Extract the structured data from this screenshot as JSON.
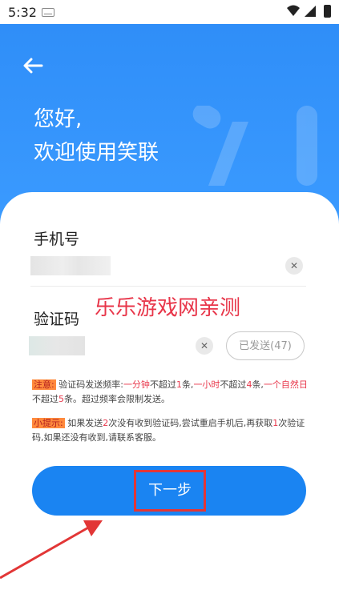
{
  "status_bar": {
    "time": "5:32"
  },
  "header": {
    "back_icon": "back-arrow-icon",
    "greeting_line1": "您好,",
    "greeting_line2": "欢迎使用笑联"
  },
  "form": {
    "phone_label": "手机号",
    "code_label": "验证码",
    "resend_label": "已发送(47)",
    "watermark": "乐乐游戏网亲测"
  },
  "notices": {
    "notice_tag": "注意:",
    "notice_text_a": "验证码发送频率:",
    "notice_red_a": "一分钟",
    "notice_text_b": "不超过",
    "notice_red_b": "1",
    "notice_text_c": "条,",
    "notice_red_c": "一小时",
    "notice_text_d": "不超过",
    "notice_red_d": "4",
    "notice_text_e": "条,",
    "notice_red_e": "一个自然日",
    "notice_text_f": "不超过",
    "notice_red_f": "5",
    "notice_text_g": "条。超过频率会限制发送。",
    "tip_tag": "小提示:",
    "tip_text_a": "如果发送",
    "tip_red_a": "2",
    "tip_text_b": "次没有收到验证码,尝试重启手机后,再获取",
    "tip_red_b": "1",
    "tip_text_c": "次验证码,如果还没有收到,请联系客服。"
  },
  "actions": {
    "next_label": "下一步"
  },
  "colors": {
    "primary": "#1a84f2",
    "hero": "#2f8ef8",
    "highlight_red": "#e23636"
  }
}
